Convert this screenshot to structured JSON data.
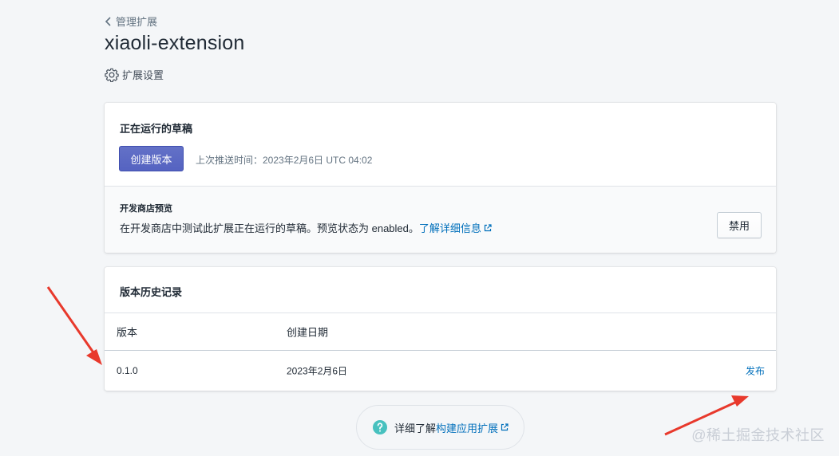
{
  "breadcrumb": {
    "label": "管理扩展"
  },
  "page": {
    "title": "xiaoli-extension"
  },
  "settings": {
    "label": "扩展设置"
  },
  "draft_card": {
    "title": "正在运行的草稿",
    "create_button": "创建版本",
    "last_push": "上次推送时间：2023年2月6日 UTC 04:02",
    "preview": {
      "heading": "开发商店预览",
      "description": "在开发商店中测试此扩展正在运行的草稿。预览状态为 enabled。",
      "learn_more": "了解详细信息",
      "disable_button": "禁用"
    }
  },
  "history_card": {
    "title": "版本历史记录",
    "columns": [
      "版本",
      "创建日期"
    ],
    "rows": [
      {
        "version": "0.1.0",
        "date": "2023年2月6日",
        "action": "发布"
      }
    ]
  },
  "help": {
    "prefix": "详细了解",
    "link": "构建应用扩展"
  },
  "watermark": "@稀土掘金技术社区",
  "colors": {
    "primary": "#5c6ac4",
    "link": "#006fbb",
    "help_icon": "#47c1bf",
    "arrow": "#e8392c"
  },
  "icons": [
    "chevron-left-icon",
    "gear-icon",
    "external-link-icon",
    "question-circle-icon"
  ]
}
